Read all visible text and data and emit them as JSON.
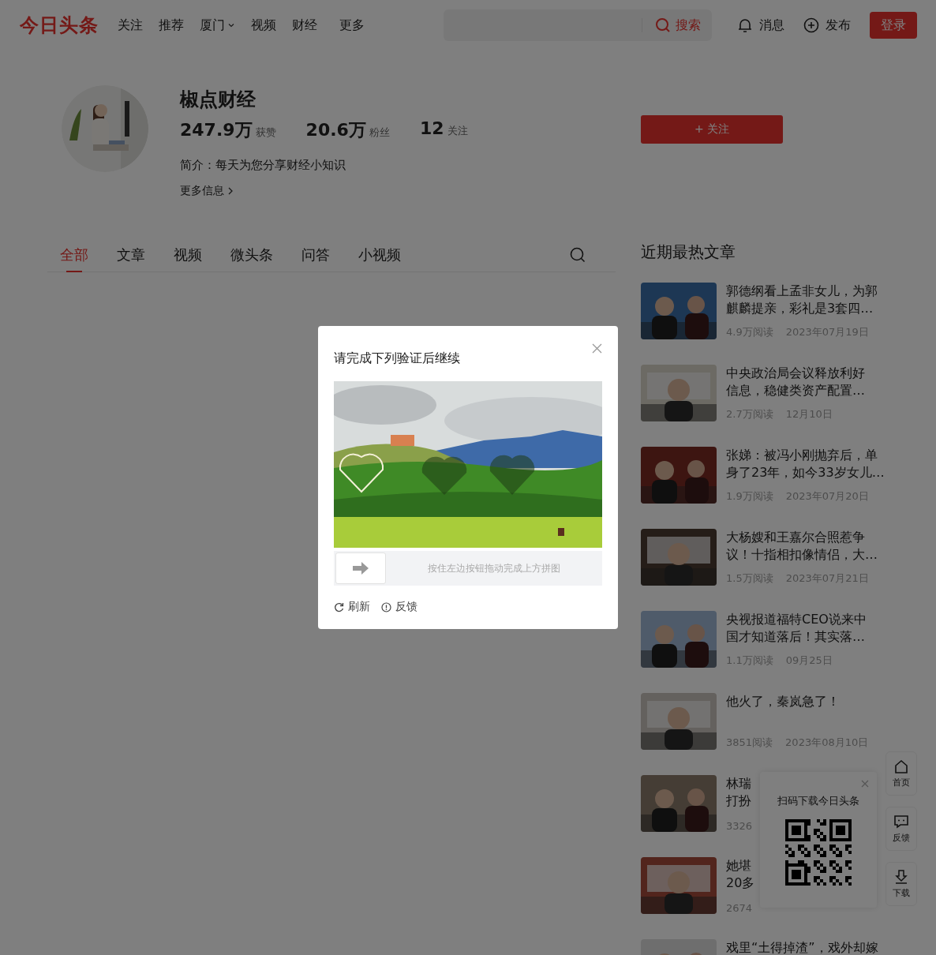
{
  "header": {
    "logo": "今日头条",
    "nav": [
      {
        "label": "关注",
        "dropdown": false
      },
      {
        "label": "推荐",
        "dropdown": false
      },
      {
        "label": "厦门",
        "dropdown": true
      },
      {
        "label": "视频",
        "dropdown": false
      },
      {
        "label": "财经",
        "dropdown": false
      },
      {
        "label": "更多",
        "dropdown": false
      }
    ],
    "search": {
      "button": "搜索"
    },
    "actions": [
      {
        "kind": "bell",
        "label": "消息"
      },
      {
        "kind": "plus",
        "label": "发布"
      }
    ],
    "login": "登录"
  },
  "profile": {
    "name": "椒点财经",
    "stats": [
      {
        "value": "247.9万",
        "label": "获赞"
      },
      {
        "value": "20.6万",
        "label": "粉丝"
      },
      {
        "value": "12",
        "label": "关注"
      }
    ],
    "intro": "简介：每天为您分享财经小知识",
    "more": "更多信息",
    "follow": "+ 关注"
  },
  "tabs": [
    {
      "label": "全部",
      "selected": true
    },
    {
      "label": "文章",
      "selected": false
    },
    {
      "label": "视频",
      "selected": false
    },
    {
      "label": "微头条",
      "selected": false
    },
    {
      "label": "问答",
      "selected": false
    },
    {
      "label": "小视频",
      "selected": false
    }
  ],
  "hot": {
    "title": "近期最热文章",
    "articles": [
      {
        "lines": [
          "郭德纲看上孟非女儿，为郭",
          "麒麟提亲，彩礼是3套四…"
        ],
        "reads": "4.9万阅读",
        "date": "2023年07月19日"
      },
      {
        "lines": [
          "中央政治局会议释放利好",
          "信息，稳健类资产配置…"
        ],
        "reads": "2.7万阅读",
        "date": "12月10日"
      },
      {
        "lines": [
          "张娣：被冯小刚抛弃后，单",
          "身了23年，如今33岁女儿…"
        ],
        "reads": "1.9万阅读",
        "date": "2023年07月20日"
      },
      {
        "lines": [
          "大杨嫂和王嘉尔合照惹争",
          "议！十指相扣像情侣，大…"
        ],
        "reads": "1.5万阅读",
        "date": "2023年07月21日"
      },
      {
        "lines": [
          "央视报道福特CEO说来中",
          "国才知道落后！其实落…"
        ],
        "reads": "1.1万阅读",
        "date": "09月25日"
      },
      {
        "lines": [
          "他火了，秦岚急了！"
        ],
        "reads": "3851阅读",
        "date": "2023年08月10日"
      },
      {
        "lines": [
          "林瑞",
          "打扮"
        ],
        "reads": "3326"
      },
      {
        "lines": [
          "她堪",
          "20多"
        ],
        "reads": "2674"
      },
      {
        "lines": [
          "戏里“土得掉渣”，戏外却嫁"
        ]
      }
    ]
  },
  "side": [
    {
      "kind": "home",
      "label": "首页"
    },
    {
      "kind": "chat",
      "label": "反馈"
    },
    {
      "kind": "download",
      "label": "下载"
    }
  ],
  "qr": {
    "title": "扫码下载今日头条"
  },
  "captcha": {
    "title": "请完成下列验证后继续",
    "hint": "按住左边按钮拖动完成上方拼图",
    "actions": [
      {
        "kind": "refresh",
        "label": "刷新"
      },
      {
        "kind": "info",
        "label": "反馈"
      }
    ]
  }
}
